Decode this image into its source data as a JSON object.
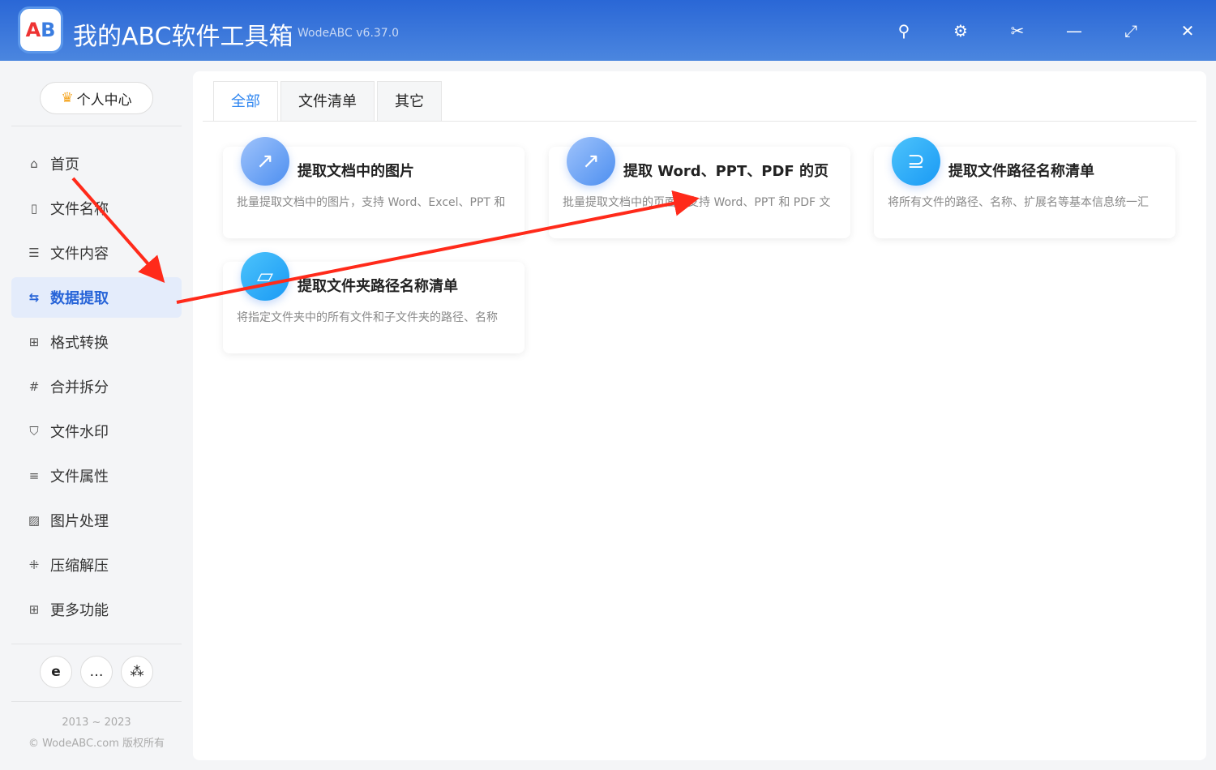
{
  "app": {
    "title": "我的ABC软件工具箱",
    "version": "WodeABC v6.37.0",
    "logo_text": "AB"
  },
  "window_buttons": [
    "search-icon",
    "gear-icon",
    "scissors-icon",
    "minimize-icon",
    "expand-icon",
    "close-icon"
  ],
  "sidebar": {
    "personal_center": "个人中心",
    "items": [
      {
        "label": "首页",
        "icon": "home-icon"
      },
      {
        "label": "文件名称",
        "icon": "file-icon"
      },
      {
        "label": "文件内容",
        "icon": "list-icon"
      },
      {
        "label": "数据提取",
        "icon": "extract-icon",
        "active": true
      },
      {
        "label": "格式转换",
        "icon": "convert-icon"
      },
      {
        "label": "合并拆分",
        "icon": "hash-icon"
      },
      {
        "label": "文件水印",
        "icon": "shield-icon"
      },
      {
        "label": "文件属性",
        "icon": "properties-icon"
      },
      {
        "label": "图片处理",
        "icon": "image-icon"
      },
      {
        "label": "压缩解压",
        "icon": "compress-icon"
      },
      {
        "label": "更多功能",
        "icon": "grid-icon"
      }
    ],
    "copyright_years": "2013 ~ 2023",
    "copyright": "© WodeABC.com 版权所有"
  },
  "tabs": [
    {
      "label": "全部",
      "active": true
    },
    {
      "label": "文件清单"
    },
    {
      "label": "其它"
    }
  ],
  "cards": [
    {
      "title": "提取文档中的图片",
      "desc": "批量提取文档中的图片，支持 Word、Excel、PPT 和"
    },
    {
      "title": "提取 Word、PPT、PDF 的页",
      "desc": "批量提取文档中的页面，支持 Word、PPT 和 PDF 文"
    },
    {
      "title": "提取文件路径名称清单",
      "desc": "将所有文件的路径、名称、扩展名等基本信息统一汇"
    },
    {
      "title": "提取文件夹路径名称清单",
      "desc": "将指定文件夹中的所有文件和子文件夹的路径、名称"
    }
  ],
  "colors": {
    "accent": "#2764d8",
    "annotation": "#ff2a1a"
  }
}
